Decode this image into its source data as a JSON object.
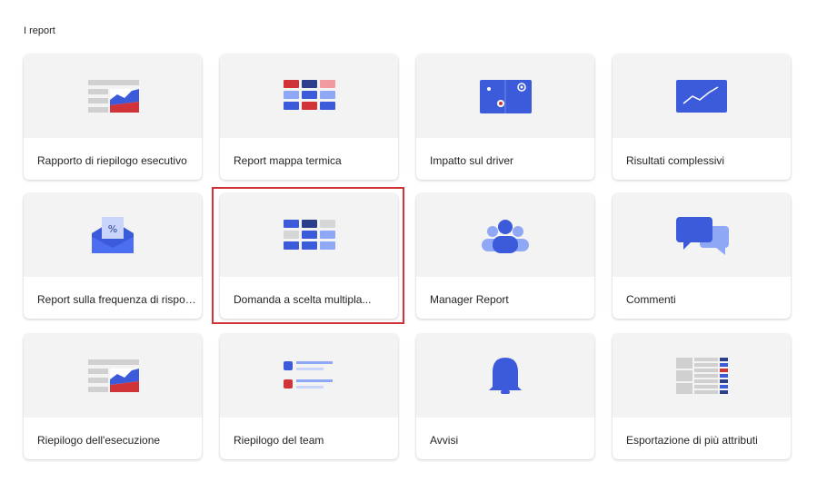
{
  "section": {
    "title": "I report"
  },
  "cards": [
    {
      "label": "Rapporto di riepilogo esecutivo",
      "icon": "executive-summary-icon"
    },
    {
      "label": "Report mappa termica",
      "icon": "heatmap-icon"
    },
    {
      "label": "Impatto sul driver",
      "icon": "driver-impact-icon"
    },
    {
      "label": "Risultati complessivi",
      "icon": "overall-results-icon"
    },
    {
      "label": "Report sulla frequenza di risposta",
      "icon": "response-rate-icon"
    },
    {
      "label": "Domanda a scelta multipla...",
      "icon": "multiple-choice-icon"
    },
    {
      "label": "Manager Report",
      "icon": "manager-report-icon"
    },
    {
      "label": "Commenti",
      "icon": "comments-icon"
    },
    {
      "label": "Riepilogo dell'esecuzione",
      "icon": "execution-summary-icon"
    },
    {
      "label": "Riepilogo del team",
      "icon": "team-summary-icon"
    },
    {
      "label": "Avvisi",
      "icon": "alerts-bell-icon"
    },
    {
      "label": "Esportazione di più attributi",
      "icon": "attribute-export-icon"
    }
  ],
  "selected_card": "Domanda a scelta multipla...",
  "colors": {
    "blue": "#3b5bdb",
    "light_blue": "#8fa8f5",
    "red": "#d13438",
    "gray": "#d6d6d6"
  }
}
